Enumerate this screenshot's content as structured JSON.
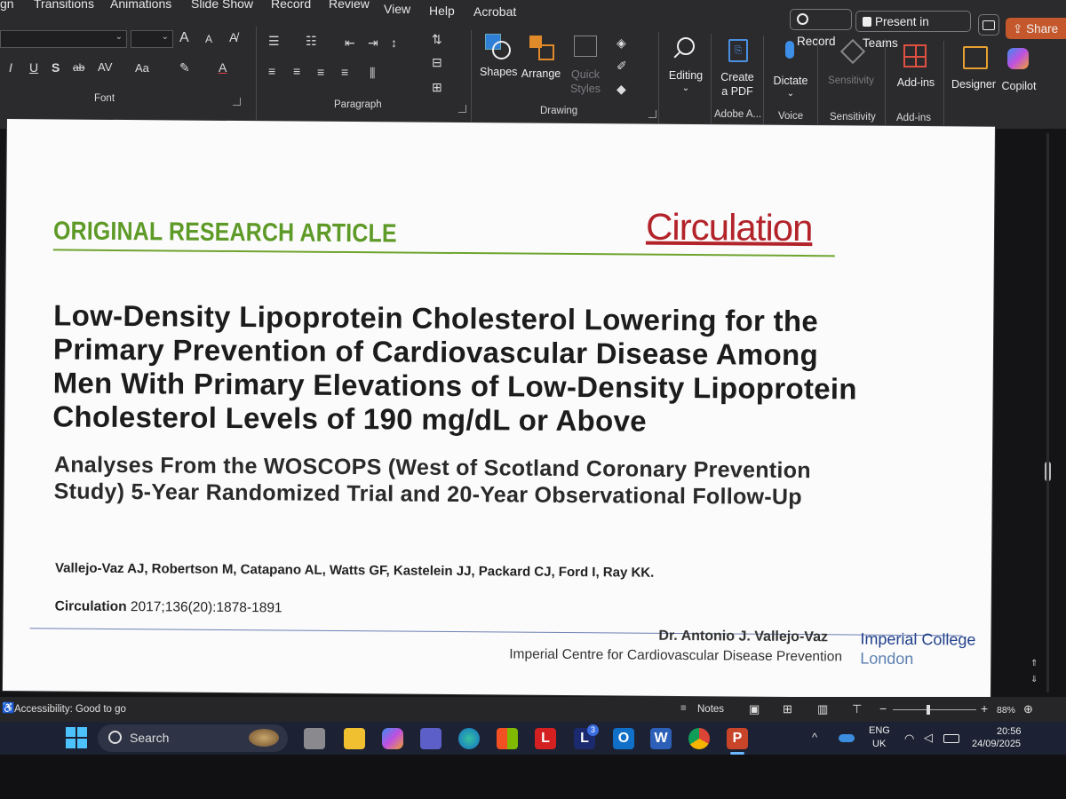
{
  "ribbon": {
    "tabs": [
      "gn",
      "Transitions",
      "Animations",
      "Slide Show",
      "Record",
      "Review",
      "View",
      "Help",
      "Acrobat"
    ],
    "record_button": "Record",
    "present_button": "Present in Teams",
    "share_button": "Share",
    "groups": {
      "font": "Font",
      "paragraph": "Paragraph",
      "drawing": "Drawing",
      "adobe": "Adobe A...",
      "voice": "Voice",
      "sensitivity": "Sensitivity",
      "addins": "Add-ins"
    },
    "font_glyphs": {
      "bold": "I",
      "underline": "U",
      "shadow": "S",
      "strike": "ab",
      "spacing": "AV",
      "case": "Aa",
      "grow": "A",
      "shrink": "A"
    },
    "buttons": {
      "shapes": "Shapes",
      "arrange": "Arrange",
      "quick_styles_1": "Quick",
      "quick_styles_2": "Styles",
      "editing": "Editing",
      "create_pdf_1": "Create",
      "create_pdf_2": "a PDF",
      "dictate": "Dictate",
      "sensitivity": "Sensitivity",
      "addins": "Add-ins",
      "designer": "Designer",
      "copilot": "Copilot"
    }
  },
  "slide": {
    "label": "ORIGINAL RESEARCH ARTICLE",
    "journal_logo": "Circulation",
    "title_lines": [
      "Low-Density Lipoprotein Cholesterol Lowering for the",
      "Primary Prevention of Cardiovascular Disease Among",
      "Men With Primary Elevations of Low-Density Lipoprotein",
      "Cholesterol Levels of 190 mg/dL or Above"
    ],
    "subtitle_lines": [
      "Analyses From the WOSCOPS (West of Scotland Coronary Prevention",
      "Study) 5-Year Randomized Trial and 20-Year Observational Follow-Up"
    ],
    "authors": "Vallejo-Vaz AJ, Robertson M, Catapano AL, Watts GF, Kastelein JJ, Packard CJ, Ford I, Ray KK.",
    "citation_journal": "Circulation",
    "citation_detail": "2017;136(20):1878-1891",
    "presenter": "Dr. Antonio J. Vallejo-Vaz",
    "institution_line": "Imperial Centre for Cardiovascular Disease Prevention",
    "logo_line1": "Imperial College",
    "logo_line2": "London"
  },
  "statusbar": {
    "accessibility": "Accessibility: Good to go",
    "notes": "Notes",
    "zoom_minus": "−",
    "zoom_plus": "+",
    "zoom": "88%"
  },
  "taskbar": {
    "search": "Search",
    "lang": "ENG",
    "region": "UK",
    "time": "20:56",
    "date": "24/09/2025",
    "badge": "3",
    "app_letters": {
      "l1": "L",
      "l2": "L",
      "outlook": "O",
      "word": "W",
      "ppt": "P"
    }
  },
  "colors": {
    "accent_green": "#5e9a27",
    "circulation_red": "#b3232a",
    "imperial_blue": "#1f3f8a",
    "share_orange": "#c4572b"
  }
}
